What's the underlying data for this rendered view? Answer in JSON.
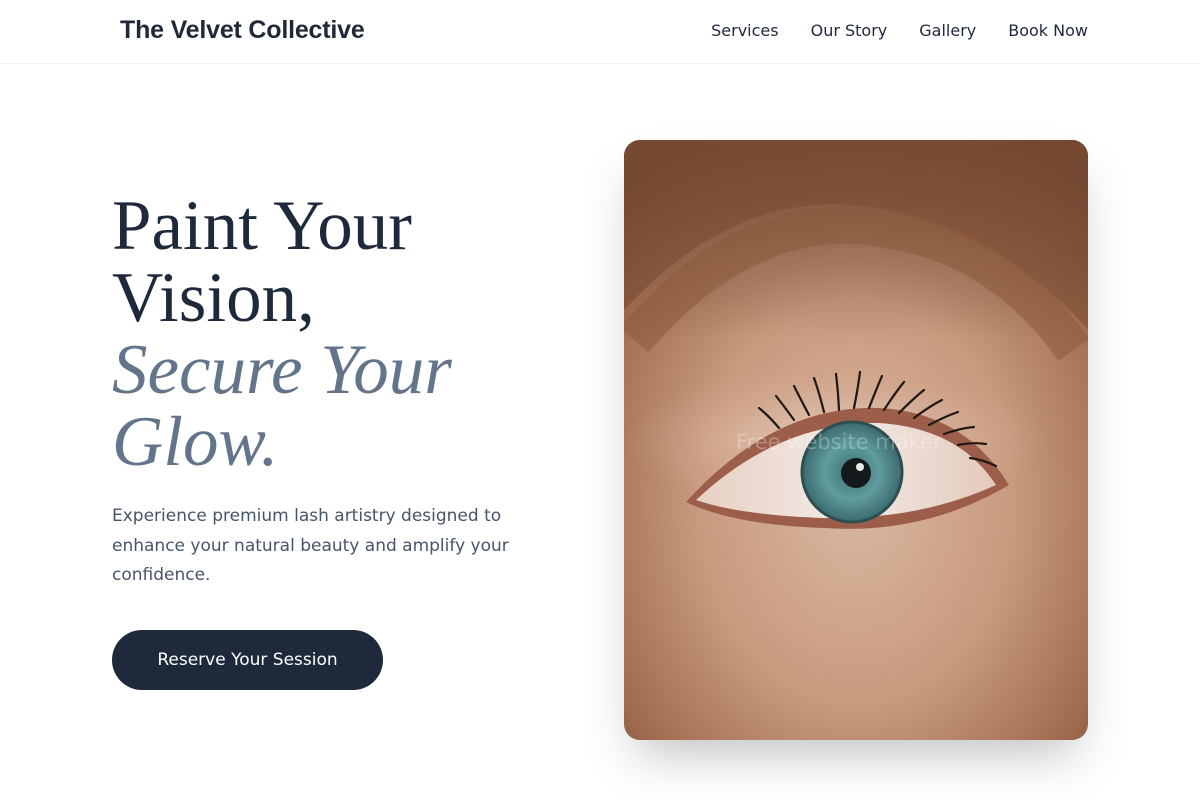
{
  "header": {
    "brand": "The Velvet Collective",
    "nav": [
      {
        "label": "Services"
      },
      {
        "label": "Our Story"
      },
      {
        "label": "Gallery"
      },
      {
        "label": "Book Now"
      }
    ]
  },
  "hero": {
    "headline_line1": "Paint Your",
    "headline_line2": "Vision,",
    "headline_accent_line1": "Secure Your",
    "headline_accent_line2": "Glow.",
    "subtext": "Experience premium lash artistry designed to enhance your natural beauty and amplify your confidence.",
    "cta_label": "Reserve Your Session",
    "image": {
      "subject": "close-up-eye-photo",
      "watermark": "Free website maker"
    }
  },
  "colors": {
    "primary": "#1e293b",
    "accent": "#64748b",
    "body_text": "#475569",
    "background": "#ffffff"
  }
}
